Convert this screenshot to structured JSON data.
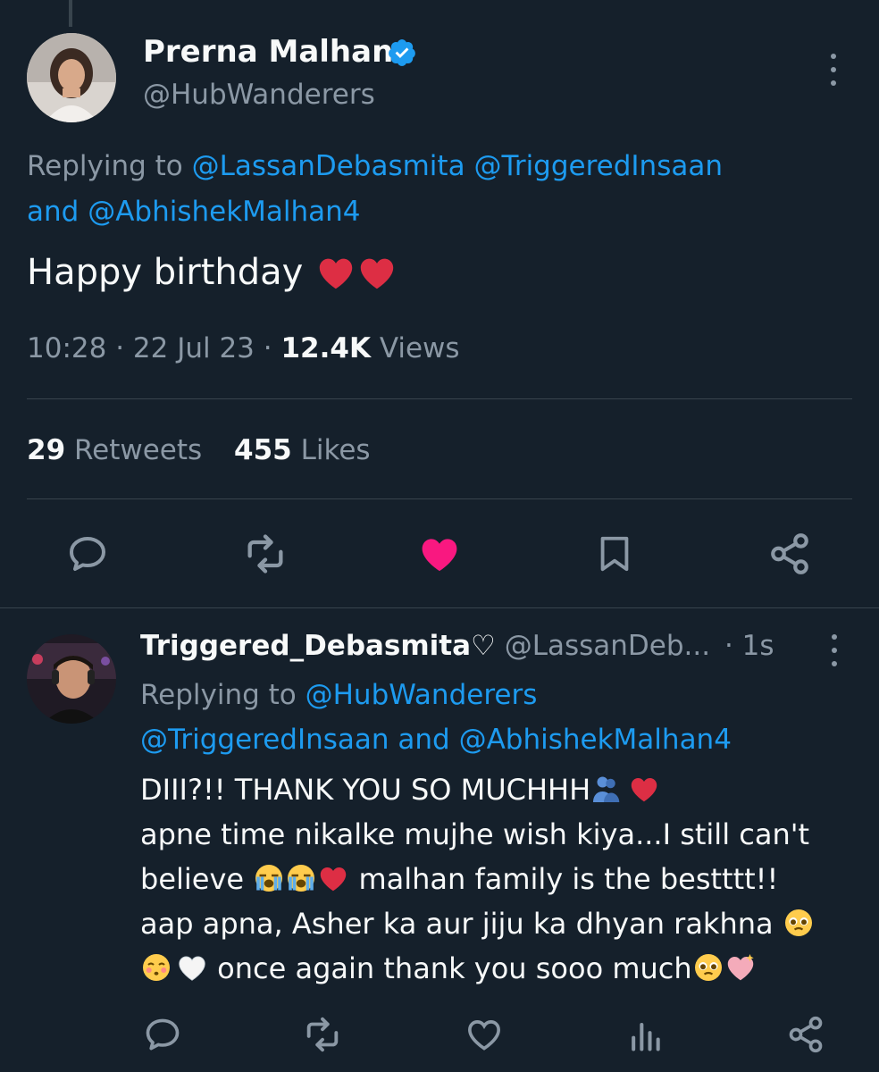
{
  "tweet": {
    "author_name": "Prerna Malhan",
    "author_handle": "@HubWanderers",
    "replying_prefix": "Replying to ",
    "replying_mentions": [
      "@LassanDebasmita",
      "@TriggeredInsaan"
    ],
    "replying_and": "and ",
    "replying_last": "@AbhishekMalhan4",
    "text": "Happy birthday",
    "time": "10:28 · 22 Jul 23 · ",
    "views_count": "12.4K",
    "views_label": " Views",
    "retweets_count": "29",
    "retweets_label": " Retweets",
    "likes_count": "455",
    "likes_label": " Likes"
  },
  "reply": {
    "author_name": "Triggered_Debasmita♡",
    "author_handle": "@LassanDeb...",
    "time": "· 1s",
    "replying_prefix": "Replying to ",
    "replying_mention_1": "@HubWanderers",
    "replying_mention_2": "@TriggeredInsaan",
    "replying_and": " and ",
    "replying_mention_3": "@AbhishekMalhan4",
    "line1": "DIII?!! THANK YOU SO MUCHHH",
    "line2": "apne time nikalke mujhe wish kiya...I still can't",
    "line3a": "believe ",
    "line3b": " malhan family is the bestttt!!",
    "line4": "aap apna, Asher ka aur jiju ka dhyan rakhna ",
    "line5a": " once again thank you sooo much"
  },
  "icons": {
    "verified": "verified-badge-icon",
    "reply": "reply-icon",
    "retweet": "retweet-icon",
    "like": "like-icon",
    "bookmark": "bookmark-icon",
    "share": "share-icon",
    "views": "views-icon",
    "more": "more-icon"
  },
  "colors": {
    "background": "#15202b",
    "accent": "#1d9bf0",
    "liked": "#f91880",
    "secondary_text": "#8b98a5"
  }
}
